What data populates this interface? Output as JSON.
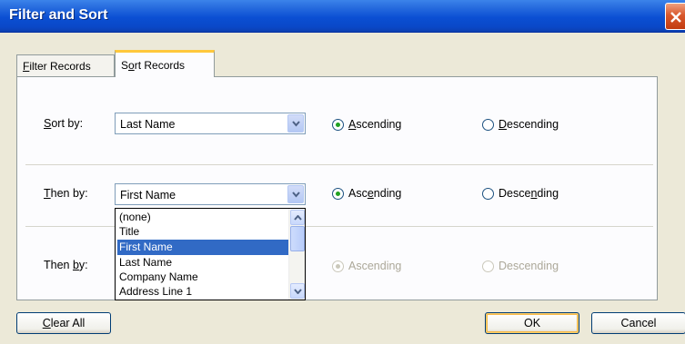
{
  "window": {
    "title": "Filter and Sort"
  },
  "tabs": [
    {
      "label_pre": "",
      "label_key": "F",
      "label_post": "ilter Records"
    },
    {
      "label_pre": "S",
      "label_key": "o",
      "label_post": "rt Records"
    }
  ],
  "sort_by": {
    "label_key": "S",
    "label_post": "ort by:",
    "value": "Last Name",
    "ascending": {
      "key": "A",
      "post": "scending"
    },
    "descending": {
      "key": "D",
      "post": "escending"
    }
  },
  "then_by_1": {
    "label_key": "T",
    "label_post": "hen by:",
    "value": "First Name",
    "ascending": {
      "pre": "Asc",
      "key": "e",
      "post": "nding"
    },
    "descending": {
      "pre": "Desce",
      "key": "n",
      "post": "ding"
    }
  },
  "then_by_2": {
    "label_pre": "Then ",
    "label_key": "b",
    "label_post": "y:",
    "ascending": "Ascending",
    "descending": "Descending"
  },
  "dropdown_options": [
    "(none)",
    "Title",
    "First Name",
    "Last Name",
    "Company Name",
    "Address Line 1"
  ],
  "dropdown_selected": "First Name",
  "buttons": {
    "clear_key": "C",
    "clear_post": "lear All",
    "ok": "OK",
    "cancel": "Cancel"
  },
  "colors": {
    "title_bar": "#0b4fd3",
    "selection": "#316ac5",
    "radio_dot": "#21a121",
    "tab_highlight": "#ffc83c"
  }
}
